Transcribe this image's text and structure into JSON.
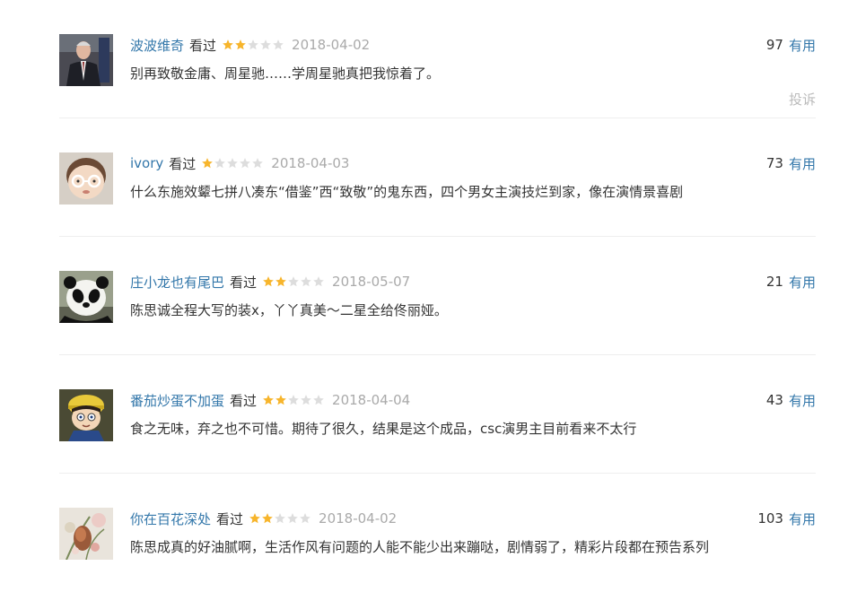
{
  "colors": {
    "link": "#3377aa",
    "text": "#333333",
    "date": "#aaaaaa",
    "star_on": "#f7b52c",
    "star_off": "#dddddd",
    "report": "#bbbbbb"
  },
  "reviews": [
    {
      "user": "波波维奇",
      "status": "看过",
      "rating": 2,
      "date": "2018-04-02",
      "votes": "97",
      "useful_label": "有用",
      "content": "别再致敬金庸、周星驰……学周星驰真把我惊着了。",
      "report_label": "投诉",
      "avatar": "man-in-suit-icon"
    },
    {
      "user": "ivory",
      "status": "看过",
      "rating": 1,
      "date": "2018-04-03",
      "votes": "73",
      "useful_label": "有用",
      "content": "什么东施效颦七拼八凑东“借鉴”西“致敬”的鬼东西，四个男女主演技烂到家，像在演情景喜剧",
      "avatar": "baby-with-glasses-icon"
    },
    {
      "user": "庄小龙也有尾巴",
      "status": "看过",
      "rating": 2,
      "date": "2018-05-07",
      "votes": "21",
      "useful_label": "有用",
      "content": "陈思诚全程大写的装x，丫丫真美～二星全给佟丽娅。",
      "avatar": "panda-icon"
    },
    {
      "user": "番茄炒蛋不加蛋",
      "status": "看过",
      "rating": 2,
      "date": "2018-04-04",
      "votes": "43",
      "useful_label": "有用",
      "content": "食之无味，弃之也不可惜。期待了很久，结果是这个成品，csc演男主目前看来不太行",
      "avatar": "cartoon-boy-icon"
    },
    {
      "user": "你在百花深处",
      "status": "看过",
      "rating": 2,
      "date": "2018-04-02",
      "votes": "103",
      "useful_label": "有用",
      "content": "陈思成真的好油腻啊，生活作风有问题的人能不能少出来蹦哒，剧情弱了，精彩片段都在预告系列",
      "avatar": "flowers-icon"
    }
  ]
}
